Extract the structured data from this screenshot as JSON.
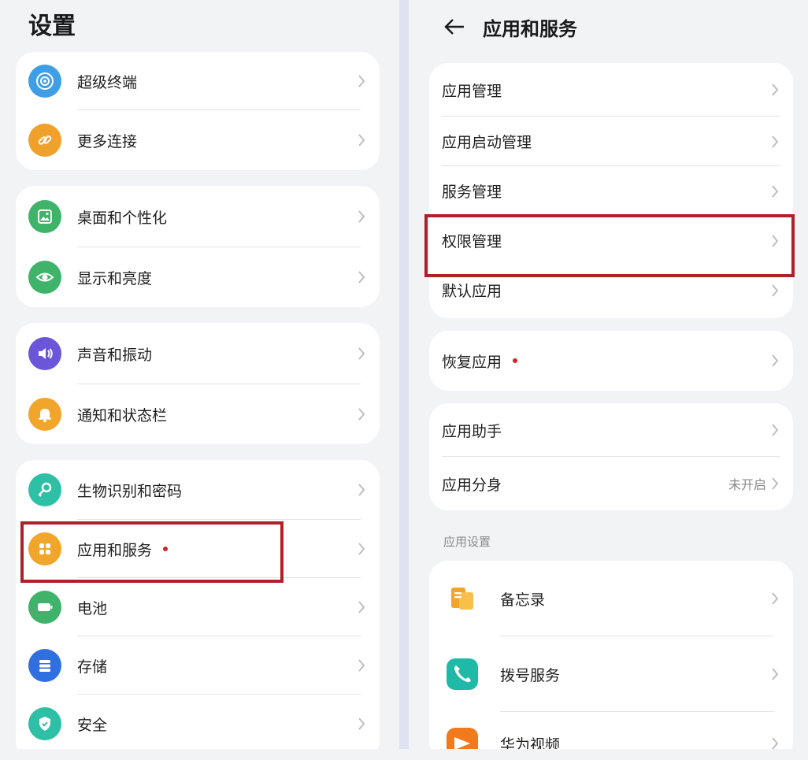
{
  "left": {
    "title": "设置",
    "groups": [
      {
        "items": [
          {
            "label": "超级终端",
            "icon": "super-device-icon",
            "color": "#3e9ee6"
          },
          {
            "label": "更多连接",
            "icon": "link-icon",
            "color": "#f0a12c"
          }
        ]
      },
      {
        "items": [
          {
            "label": "桌面和个性化",
            "icon": "wallpaper-icon",
            "color": "#3fb36a"
          },
          {
            "label": "显示和亮度",
            "icon": "eye-icon",
            "color": "#3fb36a"
          }
        ]
      },
      {
        "items": [
          {
            "label": "声音和振动",
            "icon": "speaker-icon",
            "color": "#6b55d8"
          },
          {
            "label": "通知和状态栏",
            "icon": "bell-icon",
            "color": "#f2a52b"
          }
        ]
      },
      {
        "items": [
          {
            "label": "生物识别和密码",
            "icon": "key-icon",
            "color": "#2ec0a6"
          },
          {
            "label": "应用和服务",
            "icon": "apps-icon",
            "color": "#f2a52b",
            "dot": true
          },
          {
            "label": "电池",
            "icon": "battery-icon",
            "color": "#3fb36a"
          },
          {
            "label": "存储",
            "icon": "storage-icon",
            "color": "#2f6fe0"
          },
          {
            "label": "安全",
            "icon": "shield-icon",
            "color": "#2ec0a6"
          }
        ]
      }
    ]
  },
  "right": {
    "title": "应用和服务",
    "back_icon": "back-arrow-icon",
    "group1": [
      "应用管理",
      "应用启动管理",
      "服务管理",
      "权限管理",
      "默认应用"
    ],
    "group2": {
      "label": "恢复应用",
      "dot": true
    },
    "group3": [
      {
        "label": "应用助手"
      },
      {
        "label": "应用分身",
        "value": "未开启"
      }
    ],
    "section_label": "应用设置",
    "apps": [
      {
        "label": "备忘录",
        "icon": "notepad-icon",
        "color": "#f2a52b"
      },
      {
        "label": "拨号服务",
        "icon": "phone-icon",
        "color": "#1fb9a8"
      },
      {
        "label": "华为视频",
        "icon": "video-icon",
        "color": "#f07a1c"
      }
    ]
  },
  "colors": {
    "background": "#f1f3f5",
    "card": "#ffffff",
    "highlight": "#b0202a",
    "notify_dot": "#d32424"
  }
}
